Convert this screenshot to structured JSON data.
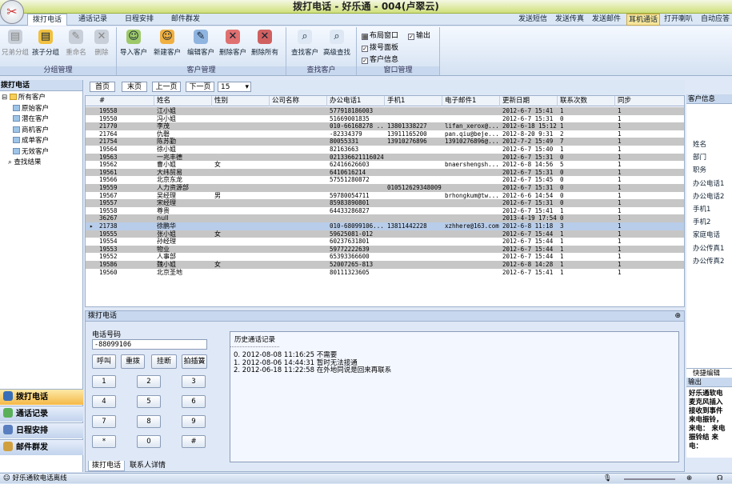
{
  "window": {
    "title": "拨打电话 - 好乐通 - 004(卢翠云)"
  },
  "menu": {
    "tabs": [
      {
        "label": "拨打电话"
      },
      {
        "label": "通话记录"
      },
      {
        "label": "日程安排"
      },
      {
        "label": "邮件群发"
      }
    ],
    "right_links": [
      {
        "label": "发送短信"
      },
      {
        "label": "发送传真"
      },
      {
        "label": "发送邮件"
      },
      {
        "label": "耳机通话"
      },
      {
        "label": "打开喇叭"
      },
      {
        "label": "自动应答"
      }
    ]
  },
  "ribbon": {
    "groups": [
      {
        "label": "分组管理",
        "buttons": [
          {
            "label": "兄弟分组"
          },
          {
            "label": "孩子分组"
          },
          {
            "label": "重命名"
          },
          {
            "label": "删除"
          }
        ]
      },
      {
        "label": "客户管理",
        "buttons": [
          {
            "label": "导入客户"
          },
          {
            "label": "新建客户"
          },
          {
            "label": "编辑客户"
          },
          {
            "label": "删除客户"
          },
          {
            "label": "删除所有"
          }
        ]
      },
      {
        "label": "查找客户",
        "buttons": [
          {
            "label": "查找客户"
          },
          {
            "label": "高级查找"
          }
        ]
      },
      {
        "label": "窗口管理",
        "checks": [
          {
            "label": "布局窗口"
          },
          {
            "label": "输出"
          },
          {
            "label": "拨号面板"
          },
          {
            "label": "客户信息"
          }
        ]
      }
    ]
  },
  "left": {
    "title": "拨打电话",
    "tree": [
      {
        "label": "所有客户"
      },
      {
        "label": "原始客户"
      },
      {
        "label": "潜在客户"
      },
      {
        "label": "商机客户"
      },
      {
        "label": "成单客户"
      },
      {
        "label": "无效客户"
      },
      {
        "label": "查找结果"
      }
    ],
    "nav": [
      {
        "label": "拨打电话"
      },
      {
        "label": "通话记录"
      },
      {
        "label": "日程安排"
      },
      {
        "label": "邮件群发"
      }
    ]
  },
  "pager": {
    "first": "首页",
    "last": "末页",
    "prev": "上一页",
    "next": "下一页",
    "page_size": "15"
  },
  "grid": {
    "columns": [
      "#",
      "姓名",
      "性别",
      "公司名称",
      "办公电话1",
      "手机1",
      "电子邮件1",
      "更新日期",
      "联系次数",
      "同步"
    ],
    "rows": [
      [
        "19558",
        "江小姐",
        "",
        "",
        "57791818600З",
        "",
        "",
        "2012-6-7 15:41",
        "1",
        "1"
      ],
      [
        "19550",
        "冯小姐",
        "",
        "",
        "51669001835",
        "",
        "",
        "2012-6-7 15:31",
        "0",
        "1"
      ],
      [
        "21770",
        "李茂",
        "",
        "",
        "010-66168278 ...",
        "13801338227",
        "lifan_xerox@...",
        "2012-6-18 15:12",
        "1",
        "1"
      ],
      [
        "21764",
        "仇磬",
        "",
        "",
        "-82334379",
        "13911165200",
        "pan.qiu@beje...",
        "2012-8-20 9:31",
        "2",
        "1"
      ],
      [
        "21754",
        "陈苏勤",
        "",
        "",
        "80055331",
        "13910276896",
        "13910276896@...",
        "2012-7-2 15:49",
        "7",
        "1"
      ],
      [
        "19564",
        "徐小姐",
        "",
        "",
        "82163663",
        "",
        "",
        "2012-6-7 15:40",
        "1",
        "1"
      ],
      [
        "19563",
        "一兆丰德",
        "",
        "",
        "021336621116024",
        "",
        "",
        "2012-6-7 15:31",
        "0",
        "1"
      ],
      [
        "19562",
        "曹小姐",
        "女",
        "",
        "62416626603",
        "",
        "bnaershengsh...",
        "2012-6-8 14:56",
        "5",
        "1"
      ],
      [
        "19561",
        "大纬贸易",
        "",
        "",
        "6410616214",
        "",
        "",
        "2012-6-7 15:31",
        "0",
        "1"
      ],
      [
        "19566",
        "北京东龙",
        "",
        "",
        "57551280872",
        "",
        "",
        "2012-6-7 15:45",
        "0",
        "1"
      ],
      [
        "19559",
        "人力资源部",
        "",
        "",
        "",
        "010512629348009",
        "",
        "2012-6-7 15:31",
        "0",
        "1"
      ],
      [
        "19567",
        "吴经理",
        "男",
        "",
        "59780054711",
        "",
        "brhongkum@tw...",
        "2012-6-6 14:54",
        "0",
        "1"
      ],
      [
        "19557",
        "宋经理",
        "",
        "",
        "85983890801",
        "",
        "",
        "2012-6-7 15:31",
        "0",
        "1"
      ],
      [
        "19558",
        "尊贵",
        "",
        "",
        "64433286827",
        "",
        "",
        "2012-6-7 15:41",
        "1",
        "1"
      ],
      [
        "36267",
        "null",
        "",
        "",
        "",
        "",
        "",
        "2013-4-19 17:54",
        "0",
        "1"
      ],
      [
        "21738",
        "徐鹏华",
        "",
        "",
        "010-68099106...",
        "13811442228",
        "xzhhere@163.com",
        "2012-6-8 11:18",
        "3",
        "1"
      ],
      [
        "19555",
        "张小姐",
        "女",
        "",
        "59625081-012",
        "",
        "",
        "2012-6-7 15:44",
        "1",
        "1"
      ],
      [
        "19554",
        "孙经理",
        "",
        "",
        "60237631801",
        "",
        "",
        "2012-6-7 15:44",
        "1",
        "1"
      ],
      [
        "19553",
        "物业",
        "",
        "",
        "59772222639",
        "",
        "",
        "2012-6-7 15:44",
        "1",
        "1"
      ],
      [
        "19552",
        "人事部",
        "",
        "",
        "65393366600",
        "",
        "",
        "2012-6-7 15:44",
        "1",
        "1"
      ],
      [
        "19586",
        "魏小姐",
        "女",
        "",
        "52007265-813",
        "",
        "",
        "2012-6-8 14:28",
        "1",
        "1"
      ],
      [
        "19560",
        "北京圣地",
        "",
        "",
        "80111323605",
        "",
        "",
        "2012-6-7 15:41",
        "1",
        "1"
      ]
    ]
  },
  "dial": {
    "panel_title": "拨打电话",
    "phone_label": "电话号码",
    "phone_value": "-88099106",
    "actions": [
      {
        "label": "呼叫"
      },
      {
        "label": "重拨"
      },
      {
        "label": "挂断"
      },
      {
        "label": "拍插簧"
      }
    ],
    "keys": [
      "1",
      "2",
      "3",
      "4",
      "5",
      "6",
      "7",
      "8",
      "9",
      "*",
      "0",
      "#"
    ]
  },
  "history": {
    "title": "历史通话记录",
    "entries": [
      "0. 2012-08-08 11:16:25 不需要",
      "1. 2012-08-06 14:44:31 暂时无法接通",
      "2. 2012-06-18 11:22:58 在外地同说是回来再联系"
    ]
  },
  "bottom_tabs": [
    {
      "label": "拨打电话"
    },
    {
      "label": "联系人详情"
    }
  ],
  "right": {
    "info_title": "客户信息",
    "fields": [
      "姓名",
      "部门",
      "职务",
      "办公电话1",
      "办公电话2",
      "手机1",
      "手机2",
      "家庭电话",
      "办公传真1",
      "办公传真2"
    ],
    "quick_edit": "快捷编辑",
    "output_title": "输出",
    "output_text": "好乐通软电 麦克风插入 接收到事件 来电振铃， 来电： 来电振铃结 来电："
  },
  "status": {
    "text": "好乐通软电话离线"
  },
  "colors": {
    "accent": "#f4b847",
    "titlebar": "#cfe07a",
    "grid_alt_row": "#c6c6c6"
  }
}
